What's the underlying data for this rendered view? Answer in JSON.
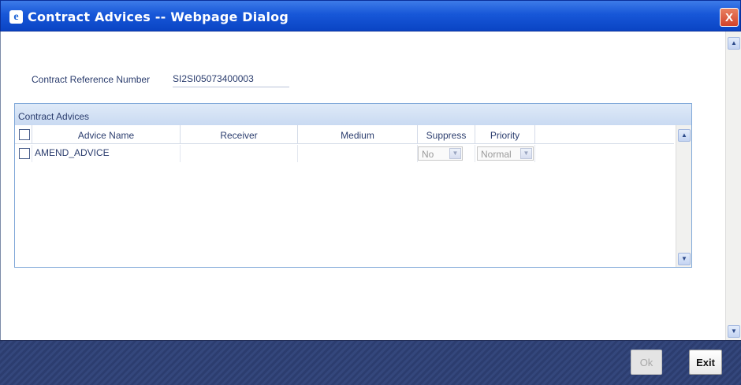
{
  "window": {
    "title": "Contract Advices -- Webpage Dialog",
    "close_glyph": "X"
  },
  "form": {
    "contract_ref_label": "Contract Reference Number",
    "contract_ref_value": "SI2SI05073400003"
  },
  "advices_panel": {
    "title": "Contract Advices",
    "columns": [
      "Advice Name",
      "Receiver",
      "Medium",
      "Suppress",
      "Priority"
    ],
    "rows": [
      {
        "advice_name": "AMEND_ADVICE",
        "receiver": "",
        "medium": "",
        "suppress": "No",
        "priority": "Normal"
      }
    ]
  },
  "buttons": {
    "ok": "Ok",
    "exit": "Exit"
  },
  "icons": {
    "window_icon": "ie-icon",
    "close": "close-icon",
    "scroll_up": "arrow-up-icon",
    "scroll_down": "arrow-down-icon",
    "dropdown": "chevron-down-icon"
  }
}
